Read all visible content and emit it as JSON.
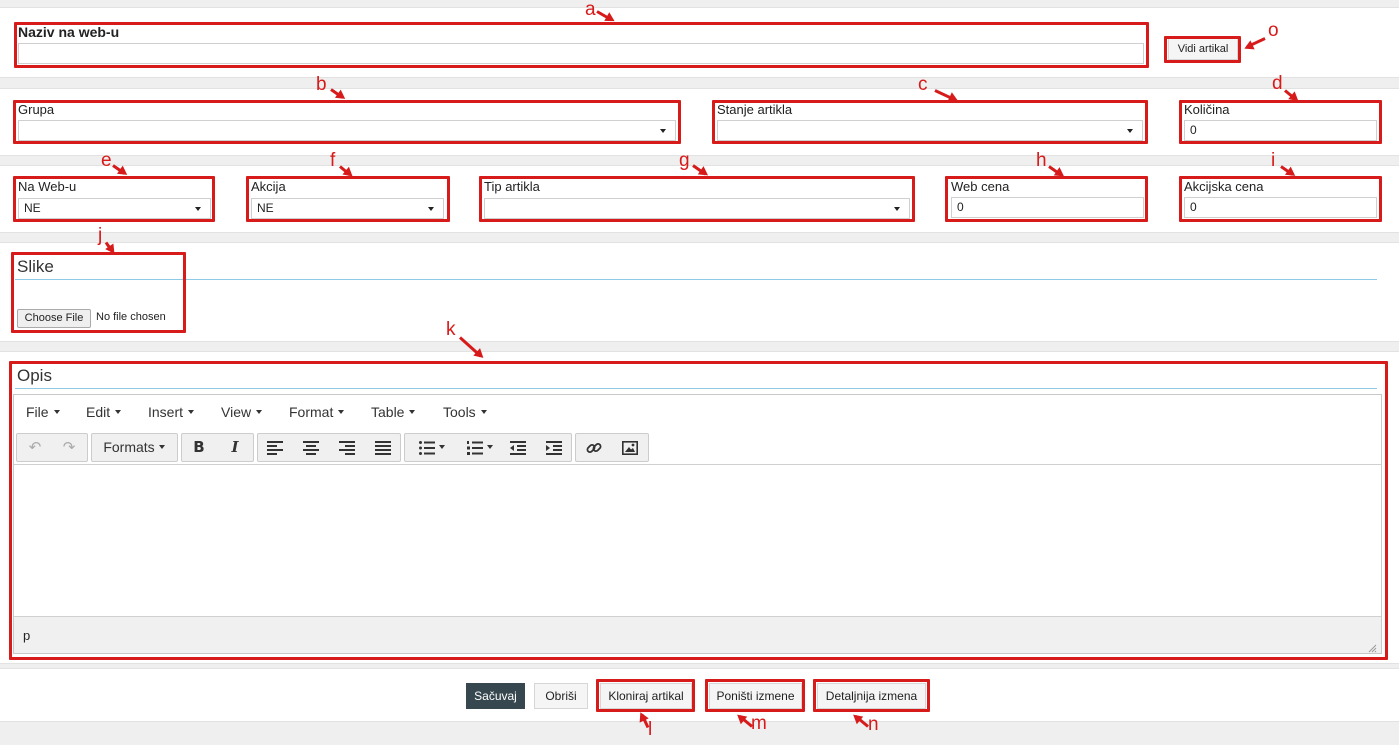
{
  "fields": {
    "naziv": {
      "label": "Naziv na web-u",
      "value": ""
    },
    "vidi_label": "Vidi artikal",
    "grupa": {
      "label": "Grupa",
      "value": ""
    },
    "stanje": {
      "label": "Stanje artikla",
      "value": ""
    },
    "kolicina": {
      "label": "Količina",
      "value": "0"
    },
    "na_web": {
      "label": "Na Web-u",
      "value": "NE"
    },
    "akcija": {
      "label": "Akcija",
      "value": "NE"
    },
    "tip": {
      "label": "Tip artikla",
      "value": ""
    },
    "web_cena": {
      "label": "Web cena",
      "value": "0"
    },
    "akcijska_cena": {
      "label": "Akcijska cena",
      "value": "0"
    }
  },
  "slike": {
    "title": "Slike",
    "choose_label": "Choose File",
    "no_file": "No file chosen"
  },
  "opis": {
    "title": "Opis",
    "menu": [
      "File",
      "Edit",
      "Insert",
      "View",
      "Format",
      "Table",
      "Tools"
    ],
    "formats_label": "Formats",
    "statusbar_path": "p"
  },
  "actions": {
    "sacuvaj": "Sačuvaj",
    "obrisi": "Obriši",
    "kloniraj": "Kloniraj artikal",
    "ponisti": "Poništi izmene",
    "detaljnija": "Detaljnija izmena"
  },
  "annotations": {
    "a": "a",
    "b": "b",
    "c": "c",
    "d": "d",
    "e": "e",
    "f": "f",
    "g": "g",
    "h": "h",
    "i": "i",
    "j": "j",
    "k": "k",
    "l": "l",
    "m": "m",
    "n": "n",
    "o": "o"
  },
  "colors": {
    "annotation_red": "#d71a1a",
    "save_button": "#37474f",
    "section_rule": "#8ecae6"
  }
}
